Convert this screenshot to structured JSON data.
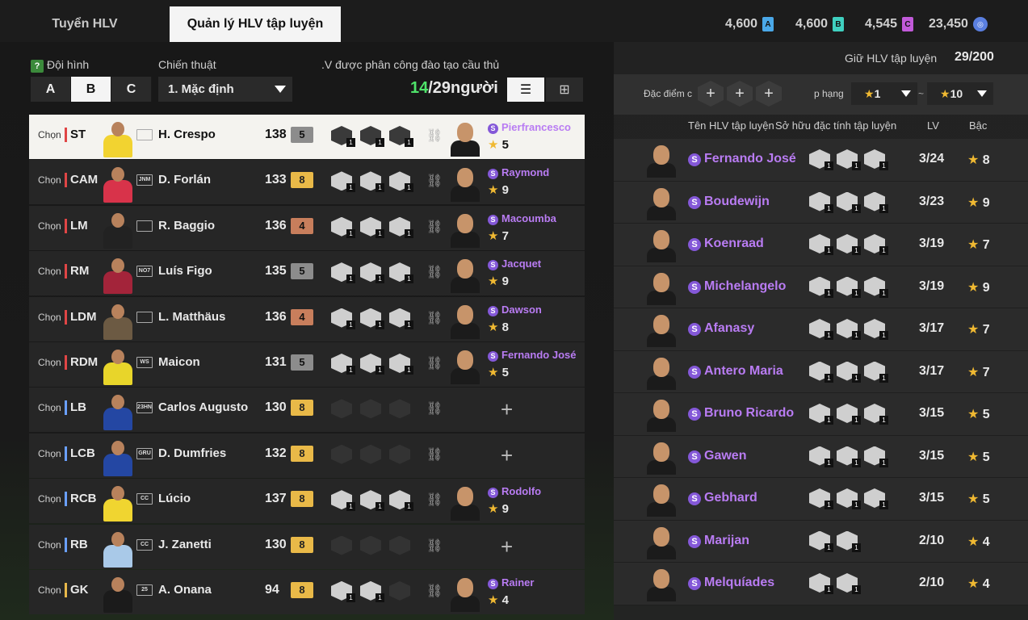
{
  "tabs": {
    "recruit": "Tuyển HLV",
    "manage": "Quản lý HLV tập luyện"
  },
  "currencies": [
    {
      "value": "4,600",
      "icon": "A",
      "color": "#4aa8e8"
    },
    {
      "value": "4,600",
      "icon": "B",
      "color": "#3fd0c0"
    },
    {
      "value": "4,545",
      "icon": "C",
      "color": "#c15ad9"
    },
    {
      "value": "23,450",
      "icon": "coin",
      "color": "#5a7fe0"
    }
  ],
  "left": {
    "squad_label": "Đội hình",
    "tactic_label": "Chiến thuật",
    "assign_label": ".V được phân công đào tạo cầu thủ",
    "squads": [
      "A",
      "B",
      "C"
    ],
    "tactic_value": "1. Mặc định",
    "assigned": "14",
    "total": "/29người",
    "choose": "Chọn"
  },
  "players": [
    {
      "pos": "ST",
      "name": "H. Crespo",
      "ovr": "138",
      "lvl": "5",
      "lvlclass": "silver",
      "card": "",
      "kit": "#f2d330",
      "traits": [
        "1",
        "1",
        "1"
      ],
      "coach": "Pierfrancesco",
      "stars": "5",
      "selected": true
    },
    {
      "pos": "CAM",
      "name": "D. Forlán",
      "ovr": "133",
      "lvl": "8",
      "lvlclass": "gold",
      "card": "JNM",
      "kit": "#d8334a",
      "traits": [
        "1",
        "1",
        "1"
      ],
      "coach": "Raymond",
      "stars": "9"
    },
    {
      "pos": "LM",
      "name": "R. Baggio",
      "ovr": "136",
      "lvl": "4",
      "lvlclass": "bronze",
      "card": "",
      "kit": "#222222",
      "traits": [
        "1",
        "1",
        "1"
      ],
      "coach": "Macoumba",
      "stars": "7"
    },
    {
      "pos": "RM",
      "name": "Luís Figo",
      "ovr": "135",
      "lvl": "5",
      "lvlclass": "silver",
      "card": "NO7",
      "kit": "#a3243a",
      "traits": [
        "1",
        "1",
        "1"
      ],
      "coach": "Jacquet",
      "stars": "9"
    },
    {
      "pos": "LDM",
      "name": "L. Matthäus",
      "ovr": "136",
      "lvl": "4",
      "lvlclass": "bronze",
      "card": "",
      "kit": "#6c5a43",
      "traits": [
        "1",
        "1",
        "1"
      ],
      "coach": "Dawson",
      "stars": "8"
    },
    {
      "pos": "RDM",
      "name": "Maicon",
      "ovr": "131",
      "lvl": "5",
      "lvlclass": "silver",
      "card": "WS",
      "kit": "#e8d52a",
      "traits": [
        "1",
        "1",
        "1"
      ],
      "coach": "Fernando José",
      "stars": "5"
    },
    {
      "pos": "LB",
      "name": "Carlos Augusto",
      "ovr": "130",
      "lvl": "8",
      "lvlclass": "gold",
      "card": "23HN",
      "kit": "#2447a3",
      "traits": [],
      "coach": "",
      "stars": ""
    },
    {
      "pos": "LCB",
      "name": "D. Dumfries",
      "ovr": "132",
      "lvl": "8",
      "lvlclass": "gold",
      "card": "GRU",
      "kit": "#2447a3",
      "traits": [],
      "coach": "",
      "stars": ""
    },
    {
      "pos": "RCB",
      "name": "Lúcio",
      "ovr": "137",
      "lvl": "8",
      "lvlclass": "gold",
      "card": "CC",
      "kit": "#f0d530",
      "traits": [
        "1",
        "1",
        "1"
      ],
      "coach": "Rodolfo",
      "stars": "9"
    },
    {
      "pos": "RB",
      "name": "J. Zanetti",
      "ovr": "130",
      "lvl": "8",
      "lvlclass": "gold",
      "card": "CC",
      "kit": "#a9c9e8",
      "traits": [],
      "coach": "",
      "stars": ""
    },
    {
      "pos": "GK",
      "name": "A. Onana",
      "ovr": "94",
      "lvl": "8",
      "lvlclass": "gold",
      "card": "25",
      "kit": "#1b1b1b",
      "traits": [
        "1",
        "1"
      ],
      "coach": "Rainer",
      "stars": "4"
    }
  ],
  "right": {
    "hold_label": "Giữ HLV tập luyện",
    "hold_value": "29/200",
    "trait_filter_label": "Đặc điểm c",
    "rank_filter_label": "p hạng",
    "rank_from": "1",
    "rank_to": "10",
    "col_name": "Tên HLV tập luyện",
    "col_traits": "Sở hữu đặc tính tập luyện",
    "col_lv": "LV",
    "col_rank": "Bậc"
  },
  "coaches": [
    {
      "name": "Fernando José",
      "traits": [
        "1",
        "1",
        "1"
      ],
      "lv": "3/24",
      "rank": "8"
    },
    {
      "name": "Boudewijn",
      "traits": [
        "1",
        "1",
        "1"
      ],
      "lv": "3/23",
      "rank": "9"
    },
    {
      "name": "Koenraad",
      "traits": [
        "1",
        "1",
        "1"
      ],
      "lv": "3/19",
      "rank": "7"
    },
    {
      "name": "Michelangelo",
      "traits": [
        "1",
        "1",
        "1"
      ],
      "lv": "3/19",
      "rank": "9"
    },
    {
      "name": "Afanasy",
      "traits": [
        "1",
        "1",
        "1"
      ],
      "lv": "3/17",
      "rank": "7"
    },
    {
      "name": "Antero Maria",
      "traits": [
        "1",
        "1",
        "1"
      ],
      "lv": "3/17",
      "rank": "7"
    },
    {
      "name": "Bruno Ricardo",
      "traits": [
        "1",
        "1",
        "1"
      ],
      "lv": "3/15",
      "rank": "5"
    },
    {
      "name": "Gawen",
      "traits": [
        "1",
        "1",
        "1"
      ],
      "lv": "3/15",
      "rank": "5"
    },
    {
      "name": "Gebhard",
      "traits": [
        "1",
        "1",
        "1"
      ],
      "lv": "3/15",
      "rank": "5"
    },
    {
      "name": "Marijan",
      "traits": [
        "1",
        "1"
      ],
      "lv": "2/10",
      "rank": "4"
    },
    {
      "name": "Melquíades",
      "traits": [
        "1",
        "1"
      ],
      "lv": "2/10",
      "rank": "4"
    }
  ]
}
